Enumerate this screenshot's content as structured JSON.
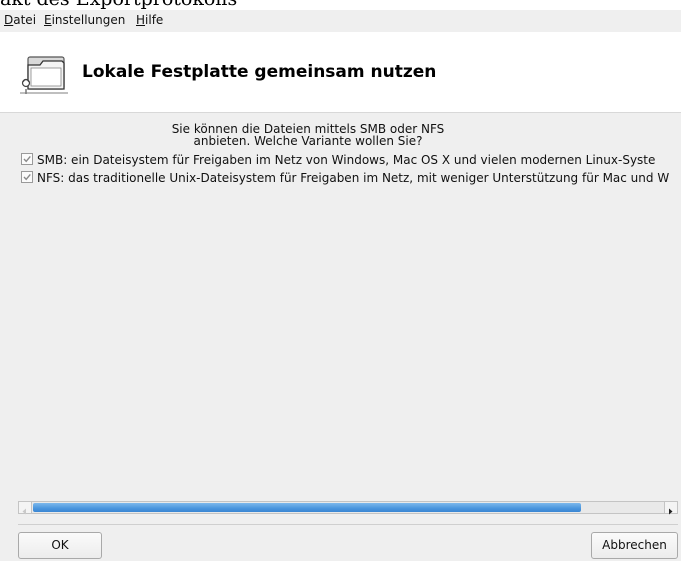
{
  "document_caption": "akt des Exportprotokolls",
  "menubar": {
    "items": [
      {
        "accel": "D",
        "rest": "atei"
      },
      {
        "accel": "E",
        "rest": "instellungen"
      },
      {
        "accel": "H",
        "rest": "ilfe"
      }
    ]
  },
  "header": {
    "title": "Lokale Festplatte gemeinsam nutzen",
    "icon": "folder-share-icon"
  },
  "intro": {
    "line1": "Sie können die Dateien mittels SMB oder NFS",
    "line2": "anbieten. Welche Variante wollen Sie?"
  },
  "options": [
    {
      "label": "SMB: ein Dateisystem für Freigaben im Netz von Windows, Mac OS X und vielen modernen Linux-Syste",
      "checked": true
    },
    {
      "label": "NFS: das traditionelle Unix-Dateisystem für Freigaben im Netz, mit weniger Unterstützung für Mac und W",
      "checked": true
    }
  ],
  "scrollbar": {
    "position": 0,
    "visible_fraction": 0.87
  },
  "buttons": {
    "ok": "OK",
    "cancel": "Abbrechen"
  },
  "colors": {
    "accent": "#4a95dd",
    "window_bg": "#efefef",
    "header_bg": "#ffffff"
  }
}
